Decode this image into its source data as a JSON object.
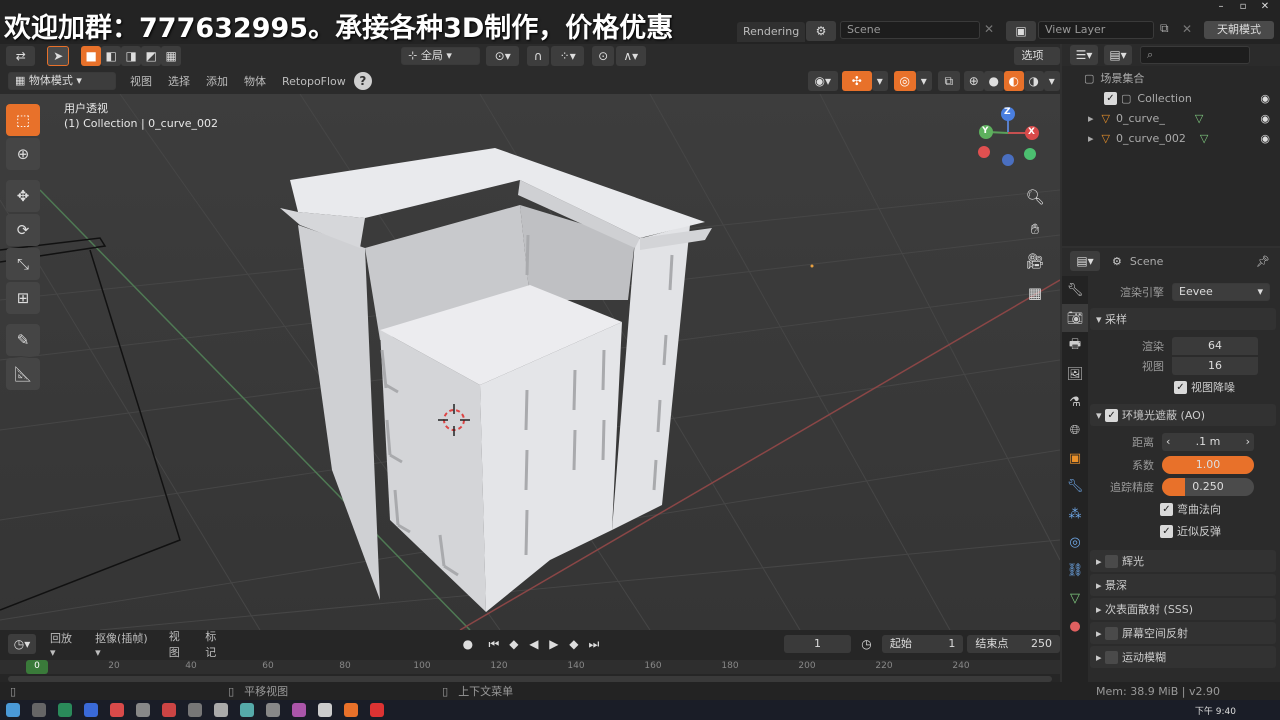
{
  "watermark": "欢迎加群：777632995。承接各种3D制作，价格优惠",
  "topbar": {
    "workspace_tab": "Rendering",
    "scene_name": "Scene",
    "view_layer": "View Layer",
    "topright_button": "天朝模式"
  },
  "header1": {
    "transform_orientation": "全局",
    "options_label": "选项"
  },
  "header2": {
    "mode": "物体模式",
    "menus": [
      "视图",
      "选择",
      "添加",
      "物体",
      "RetopoFlow"
    ]
  },
  "viewport": {
    "view_name": "用户透视",
    "active_info": "(1) Collection | 0_curve_002",
    "gizmo_labels": {
      "x": "X",
      "y": "Y",
      "z": "Z"
    }
  },
  "outliner": {
    "root": "场景集合",
    "collection": "Collection",
    "objects": [
      "0_curve_",
      "0_curve_002"
    ]
  },
  "properties": {
    "scene_label": "Scene",
    "render_engine_label": "渲染引擎",
    "render_engine_value": "Eevee",
    "sampling": {
      "header": "采样",
      "render_label": "渲染",
      "render_value": "64",
      "viewport_label": "视图",
      "viewport_value": "16",
      "denoise_label": "视图降噪"
    },
    "ao": {
      "header": "环境光遮蔽 (AO)",
      "distance_label": "距离",
      "distance_value": ".1 m",
      "factor_label": "系数",
      "factor_value": "1.00",
      "factor_fill": 1.0,
      "trace_label": "追踪精度",
      "trace_value": "0.250",
      "trace_fill": 0.25,
      "bent_normals": "弯曲法向",
      "bounce": "近似反弹"
    },
    "collapsed_sections": [
      "辉光",
      "景深",
      "次表面散射 (SSS)",
      "屏幕空间反射",
      "运动模糊"
    ]
  },
  "timeline": {
    "playback": "回放",
    "keying": "抠像(插帧)",
    "view": "视图",
    "marker": "标记",
    "current_frame": "1",
    "start_label": "起始",
    "start_value": "1",
    "end_label": "结束点",
    "end_value": "250",
    "ruler": [
      "0",
      "20",
      "40",
      "60",
      "80",
      "100",
      "120",
      "140",
      "160",
      "180",
      "200",
      "220",
      "240"
    ]
  },
  "statusbar": {
    "hint1": "平移视图",
    "hint2": "上下文菜单",
    "memory": "Mem: 38.9 MiB | v2.90"
  },
  "taskbar": {
    "time": "下午 9:40"
  },
  "colors": {
    "accent": "#e8712a",
    "background": "#303030",
    "panel": "#2b2b2b",
    "model": "#dcdde0"
  }
}
